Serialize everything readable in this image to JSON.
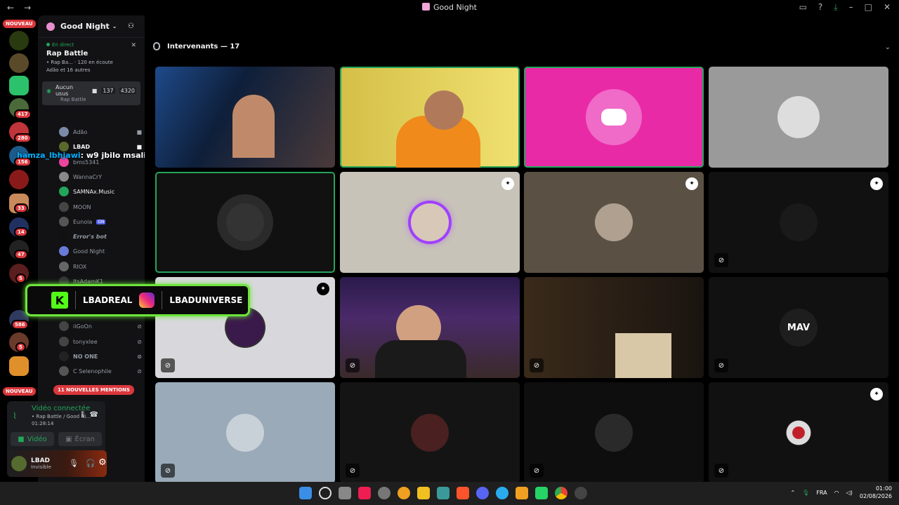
{
  "window": {
    "title": "Good Night"
  },
  "servers": {
    "new_label": "NOUVEAU",
    "badges": [
      "417",
      "280",
      "156",
      "33",
      "14",
      "47",
      "5",
      "586",
      "5"
    ]
  },
  "channel_header": {
    "server_name": "Good Night"
  },
  "live": {
    "status": "En direct",
    "title": "Rap Battle",
    "meta": "• Rap Ba...",
    "listeners": "120 en écoute",
    "users": "Adão et 16 autres"
  },
  "voice_channel": {
    "label": "Aucun usus",
    "name": "Rap Battle",
    "count1": "137",
    "count2": "4320"
  },
  "members": [
    "Adão",
    "LBAD",
    "bms5341",
    "WannaCrY",
    "SAMNAx.Music",
    "MOON",
    "Eunoia",
    "Error's bot",
    "Good Night",
    "RIOX",
    "ItsAdamK1",
    "iiGoOn",
    "tonyxlee",
    "NO ONE",
    "C Selenophile"
  ],
  "member_tags": {
    "moon": "MOON",
    "eunoia": "GN"
  },
  "chat_overlay": {
    "user": "hamza_lbhjawi",
    "message": ": w9 jbilo msali kro"
  },
  "mentions": "11 NOUVELLES MENTIONS",
  "voice_status": {
    "title": "Vidéo connectée",
    "subtitle": "• Rap Battle / Good Ni...",
    "timer": "01:28:14",
    "video_btn": "Vidéo",
    "screen_btn": "Écran"
  },
  "user_panel": {
    "name": "LBAD",
    "status": "Invisible"
  },
  "stage": {
    "header": "Intervenants — 17"
  },
  "stream_overlay": {
    "kick": "LBADREAL",
    "instagram": "LBADUNIVERSE",
    "kick_letter": "K"
  },
  "tiles_text": {
    "mav": "MAV"
  },
  "taskbar": {
    "lang": "FRA",
    "time": "01:00",
    "date": "02/08/2026"
  },
  "colors": {
    "accent_green": "#23a55a",
    "discord_pink": "#e92aa7",
    "kick_green": "#53fc18"
  }
}
